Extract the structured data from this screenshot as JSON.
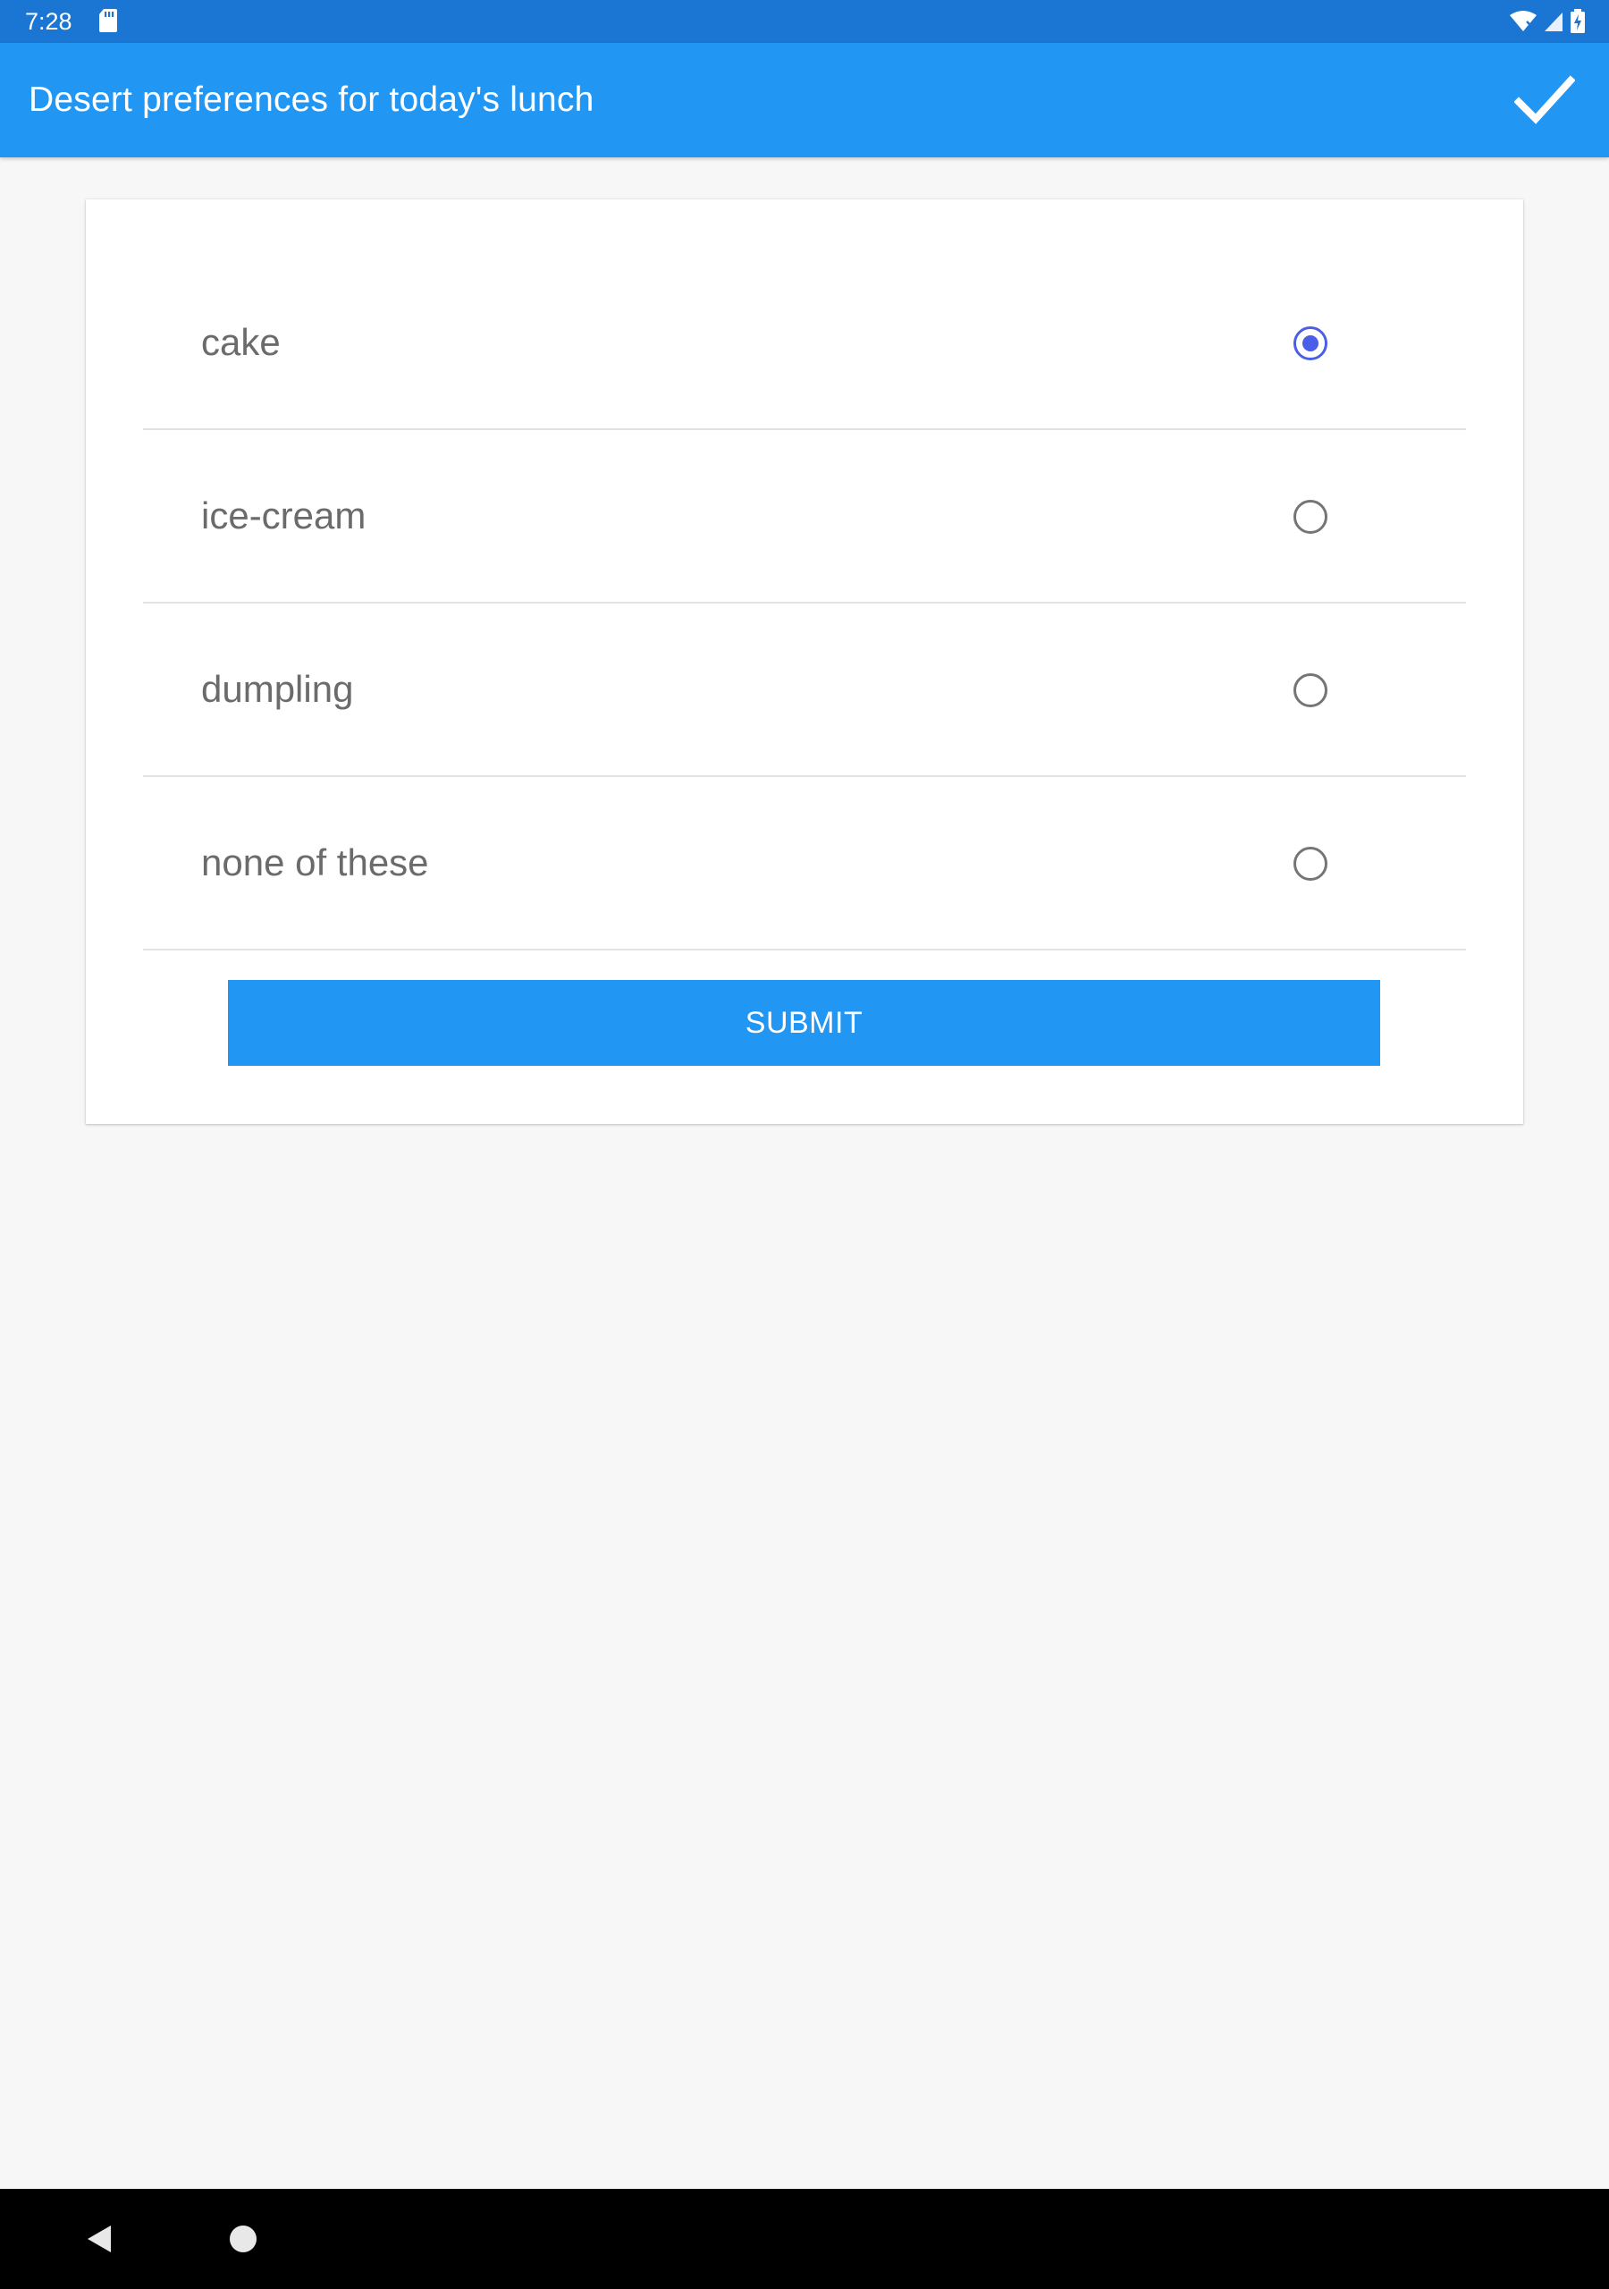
{
  "status_bar": {
    "time": "7:28",
    "icons": [
      "sd-card-icon",
      "wifi-icon",
      "signal-icon",
      "battery-icon"
    ]
  },
  "app_bar": {
    "title": "Desert preferences for today's lunch",
    "action_icon": "check-icon"
  },
  "form": {
    "options": [
      {
        "label": "cake",
        "selected": true
      },
      {
        "label": "ice-cream",
        "selected": false
      },
      {
        "label": "dumpling",
        "selected": false
      },
      {
        "label": "none of these",
        "selected": false
      }
    ],
    "submit_label": "SUBMIT"
  },
  "nav_bar": {
    "icons": [
      "back-icon",
      "home-icon"
    ]
  },
  "colors": {
    "status_bar": "#1a76d2",
    "app_bar": "#2196f3",
    "radio_selected": "#4a5ee8",
    "background": "#f7f7f7"
  }
}
